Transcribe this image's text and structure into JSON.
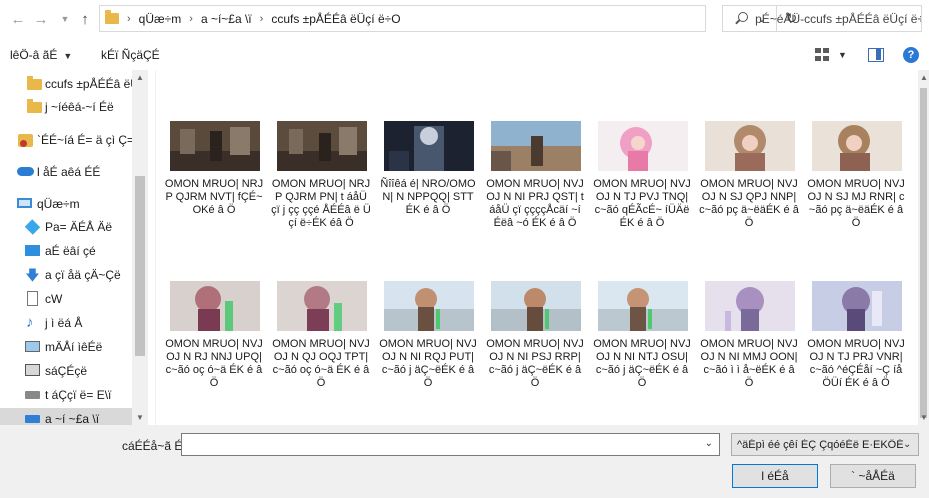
{
  "address": {
    "crumbs": [
      "qÜæ÷m",
      "a ~í~£a \\ï",
      "ccufs ±pÅÉÉâ ëÜçí ë÷O"
    ],
    "separator": "›"
  },
  "search": {
    "placeholder": "pÉ~éÅÜ-ccufs ±pÅÉÉâ ëÜçí ë÷O"
  },
  "toolbar": {
    "organize": "lêÖ-â ãÉ",
    "new_folder": "kÉï ÑçäÇÉ"
  },
  "navpane": {
    "items": [
      {
        "label": "ccufs ±pÅÉÉâ ëÜç",
        "icon": "folder-icon"
      },
      {
        "label": "j ~íéêá-~í Éë",
        "icon": "folder-icon"
      },
      {
        "label": "`ÉÉ~íá É= ä çì Ç=ç â",
        "icon": "onenote-icon"
      },
      {
        "label": "l åÉ aêá ÉÉ",
        "icon": "onedrive-icon"
      },
      {
        "label": "qÜæ÷m",
        "icon": "pc-icon"
      },
      {
        "label": "Pa= ÄÉÅ Äë",
        "icon": "3d-objects-icon"
      },
      {
        "label": "aÉ ëâí çé",
        "icon": "desktop-icon"
      },
      {
        "label": "a çï åä çÄ~Çë",
        "icon": "downloads-icon"
      },
      {
        "label": "cW",
        "icon": "documents-icon"
      },
      {
        "label": "j ì ëá Å",
        "icon": "music-icon"
      },
      {
        "label": "mÄÅí ìêÉë",
        "icon": "pictures-icon"
      },
      {
        "label": "sáÇÉçë",
        "icon": "videos-icon"
      },
      {
        "label": "t áÇçï ë= E\\ï",
        "icon": "drive-icon"
      },
      {
        "label": "a ~í ~£a \\ï",
        "icon": "drive-icon"
      }
    ]
  },
  "files": [
    {
      "label": "OMON MRUO| NRJP QJRM NVT| fÇÉ~ OKé â Ö"
    },
    {
      "label": "OMON MRUO| NRJP QJRM PN| t áåÜ çï j çç ççé ÅÉÉâ ë Üçí ë÷ÉK éâ Ö"
    },
    {
      "label": "Ñîîêá é| NRO/OMON| N NPPQQ| STT ÉK é â Ö"
    },
    {
      "label": "OMON MRUO| NVJ OJ N NI PRJ QST| t áåÜ çï ççççÅcäí ~í Éëâ ~ó ÉK é â Ö"
    },
    {
      "label": "OMON MRUO| NVJ OJ N TJ PVJ TNQ| c~ãó qÉÃcÉ~ íÜÄë ÉK é â Ö"
    },
    {
      "label": "OMON MRUO| NVJ OJ N SJ QPJ NNP| c~ãó pç ä~ëäÉK é â Ö"
    },
    {
      "label": "OMON MRUO| NVJ OJ N SJ MJ RNR| c~ãó pç ä~ëäÉK é â Ö"
    },
    {
      "label": "OMON MRUO| NVJ OJ N RJ NNJ UPQ| c~ãó oç ó~ä ÉK é â Ö"
    },
    {
      "label": "OMON MRUO| NVJ OJ N QJ OQJ TPT| c~ãó oç ó~ä ÉK é â Ö"
    },
    {
      "label": "OMON MRUO| NVJ OJ N NI RQJ PUT| c~ãó j äÇ~ëÉK é â Ö"
    },
    {
      "label": "OMON MRUO| NVJ OJ N NI PSJ RRP| c~ãó j äÇ~ëÉK é â Ö"
    },
    {
      "label": "OMON MRUO| NVJ OJ N NI NTJ OSU| c~ãó j äÇ~ëÉK é â Ö"
    },
    {
      "label": "OMON MRUO| NVJ OJ N NI MMJ OON| c~ãó ì ì å~ëÉK é â Ö"
    },
    {
      "label": "OMON MRUO| NVJ OJ N TJ PRJ VNR| c~ãó ^éÇÉåí ~Ç íåÖÜí ÉK é â Ö"
    }
  ],
  "bottom": {
    "file_name_label": "cáÉÉå~ã É\\",
    "file_name_value": "",
    "filter": "^äÉpì éé çêí ÉÇ ÇqóéÉë E·EKÖÉÖKOÖEKÉ",
    "open_button": "l éÉå",
    "cancel_button": "` ~åÅÉä"
  },
  "colors": {
    "folder": "#e8b94a",
    "accent": "#0078d7",
    "selected": "#d9d9d9"
  }
}
